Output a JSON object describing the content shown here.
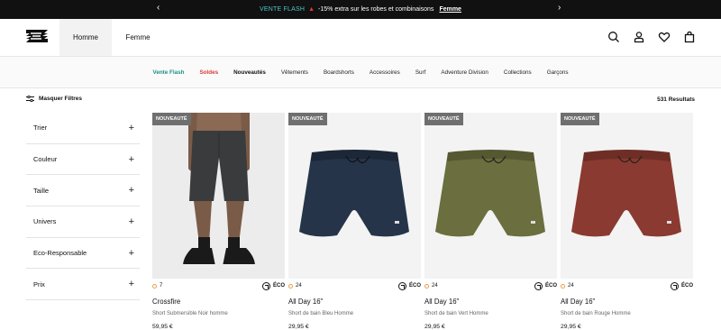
{
  "promo": {
    "flash": "VENTE FLASH",
    "text": "-15% extra sur les robes et combinaisons",
    "link": "Femme"
  },
  "header": {
    "tabs": [
      "Homme",
      "Femme"
    ],
    "icons": [
      "search-icon",
      "account-icon",
      "heart-icon",
      "bag-icon"
    ]
  },
  "nav": {
    "items": [
      "Vente Flash",
      "Soldes",
      "Nouveautés",
      "Vêtements",
      "Boardshorts",
      "Accessoires",
      "Surf",
      "Adventure Division",
      "Collections",
      "Garçons"
    ]
  },
  "filterbar": {
    "hide_label": "Masquer Filtres",
    "results": "531 Resultats"
  },
  "filters": [
    "Trier",
    "Couleur",
    "Taille",
    "Univers",
    "Eco-Responsable",
    "Prix"
  ],
  "products": [
    {
      "badge": "NOUVEAUTÉ",
      "colors": "7",
      "eco": "ÉCO",
      "name": "Crossfire",
      "desc": "Short Submersible Noir homme",
      "price": "59,95 €",
      "color": "#3a3b3d"
    },
    {
      "badge": "NOUVEAUTÉ",
      "colors": "24",
      "eco": "ÉCO",
      "name": "All Day 16\"",
      "desc": "Short de bain Bleu Homme",
      "price": "29,95 €",
      "color": "#26344a"
    },
    {
      "badge": "NOUVEAUTÉ",
      "colors": "24",
      "eco": "ÉCO",
      "name": "All Day 16\"",
      "desc": "Short de bain Vert Homme",
      "price": "29,95 €",
      "color": "#6b6e3e"
    },
    {
      "badge": "NOUVEAUTÉ",
      "colors": "24",
      "eco": "ÉCO",
      "name": "All Day 16\"",
      "desc": "Short de bain Rouge Homme",
      "price": "29,95 €",
      "color": "#8a3a30"
    }
  ]
}
